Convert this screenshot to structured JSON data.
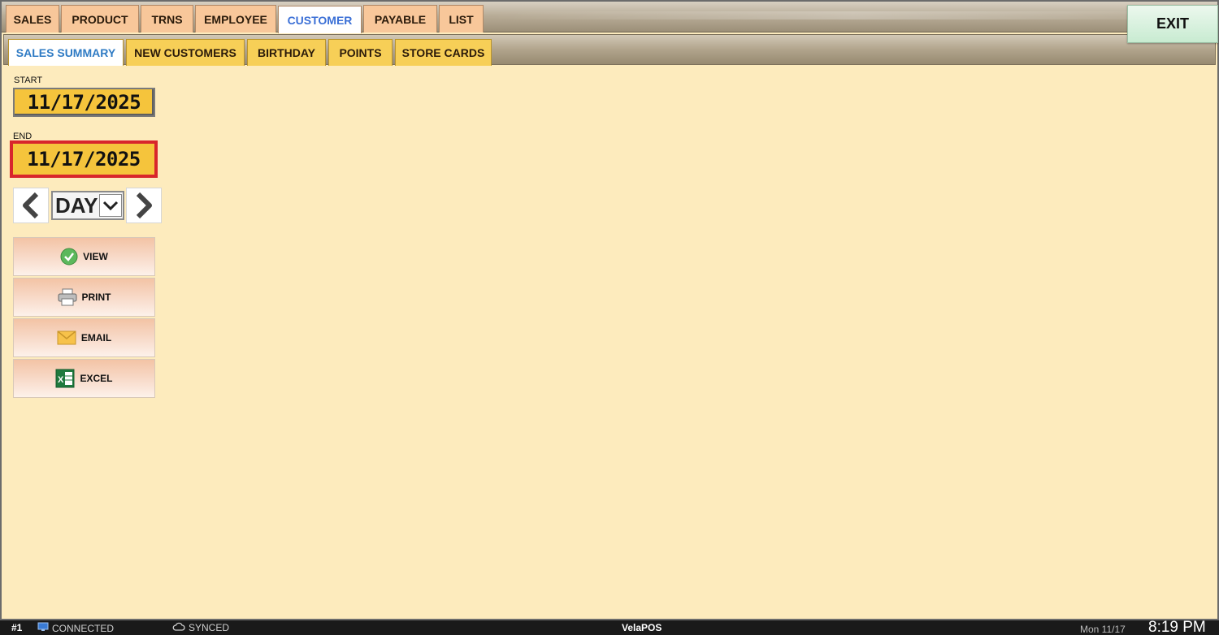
{
  "top_tabs": [
    {
      "label": "SALES"
    },
    {
      "label": "PRODUCT"
    },
    {
      "label": "TRNS"
    },
    {
      "label": "EMPLOYEE"
    },
    {
      "label": "CUSTOMER",
      "active": true
    },
    {
      "label": "PAYABLE"
    },
    {
      "label": "LIST"
    }
  ],
  "sub_tabs": [
    {
      "label": "SALES SUMMARY",
      "active": true
    },
    {
      "label": "NEW CUSTOMERS"
    },
    {
      "label": "BIRTHDAY"
    },
    {
      "label": "POINTS"
    },
    {
      "label": "STORE CARDS"
    }
  ],
  "exit_label": "EXIT",
  "start": {
    "label": "START",
    "value": "11/17/2025"
  },
  "end": {
    "label": "END",
    "value": "11/17/2025"
  },
  "period": {
    "value": "DAY",
    "prev_icon": "chevron-left-icon",
    "next_icon": "chevron-right-icon"
  },
  "actions": [
    {
      "label": "VIEW",
      "icon": "check-circle-icon"
    },
    {
      "label": "PRINT",
      "icon": "printer-icon"
    },
    {
      "label": "EMAIL",
      "icon": "envelope-icon"
    },
    {
      "label": "EXCEL",
      "icon": "excel-icon"
    }
  ],
  "status": {
    "station": "#1",
    "connection": "CONNECTED",
    "sync": "SYNCED",
    "app_name_prefix": "Vela",
    "app_name_suffix": "POS",
    "date": "Mon 11/17",
    "time": "8:19 PM"
  },
  "colors": {
    "background": "#fdebbd",
    "date_field": "#f5c43c",
    "selected_border": "#d8262c",
    "active_tab_text": "#3a6fd6"
  }
}
